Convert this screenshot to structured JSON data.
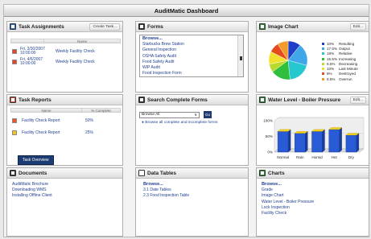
{
  "window": {
    "title": "AuditMatic Dashboard"
  },
  "panels": {
    "task_assignments": {
      "title": "Task Assignments",
      "button": "Create Task...",
      "column_name": "Name",
      "rows": [
        {
          "date": "Fri, 3/30/2007",
          "time": "10:00:00",
          "name": "Weekly Facility Check"
        },
        {
          "date": "Fri, 4/6/2007",
          "time": "10:00:00",
          "name": "Weekly Facility Check"
        }
      ]
    },
    "forms": {
      "title": "Forms",
      "items": [
        "Browse...",
        "Starbucks Brew Station",
        "General Inspection",
        "OSHA Safety Audit",
        "Food Safety Audit",
        "WIP Audit",
        "Food Inspection Form"
      ]
    },
    "image_chart": {
      "title": "Image Chart",
      "button": "Edit...",
      "legend": [
        {
          "percent": "10%",
          "label": "Resulting",
          "color": "#1f3dc6"
        },
        {
          "percent": "17.5%",
          "label": "Output",
          "color": "#3fa6e8"
        },
        {
          "percent": "18%",
          "label": "Relative",
          "color": "#26c8d0"
        },
        {
          "percent": "15.5%",
          "label": "Increasing",
          "color": "#2fbf3d"
        },
        {
          "percent": "6.5%",
          "label": "Decreasing",
          "color": "#b8d82a"
        },
        {
          "percent": "10%",
          "label": "Last Minute",
          "color": "#f0e12e"
        },
        {
          "percent": "8%",
          "label": "Destroyed",
          "color": "#e64b1d"
        },
        {
          "percent": "8.5%",
          "label": "Overrun",
          "color": "#f29b2a"
        }
      ]
    },
    "task_reports": {
      "title": "Task Reports",
      "col_name": "Name",
      "col_complete": "% Complete",
      "rows": [
        {
          "name": "Facility Check Report",
          "percent": "50%"
        },
        {
          "name": "Facility Check Report",
          "percent": "25%"
        }
      ],
      "button": "Task Overview"
    },
    "search_forms": {
      "title": "Search Complete Forms",
      "select_value": "Browse All",
      "go": "Go",
      "text": "Browse all complete and incomplete forms"
    },
    "water_level": {
      "title": "Water Level - Boiler Pressure",
      "button": "Edit...",
      "ytick_labels": [
        "100%",
        "50%",
        "0%"
      ],
      "categories": [
        "Normal",
        "Rain",
        "Humid",
        "Hot",
        "Dry"
      ],
      "values": [
        0.66,
        0.6,
        0.66,
        0.72,
        0.54
      ],
      "bar_color": "#2a5bd7",
      "top_color": "#f2d21a"
    },
    "documents": {
      "title": "Documents",
      "items": [
        "AuditMatic Brochure",
        "Downloading WMS",
        "Installing Offline Client"
      ]
    },
    "data_tables": {
      "title": "Data Tables",
      "items": [
        "Browse...",
        "3.1 Date Tables",
        "2.3 Food Inspection Table"
      ]
    },
    "charts": {
      "title": "Charts",
      "items": [
        "Browse...",
        "Grade",
        "Image Chart",
        "Water Level - Boiler Pressure",
        "Lock Inspection",
        "Facility Check"
      ]
    }
  }
}
